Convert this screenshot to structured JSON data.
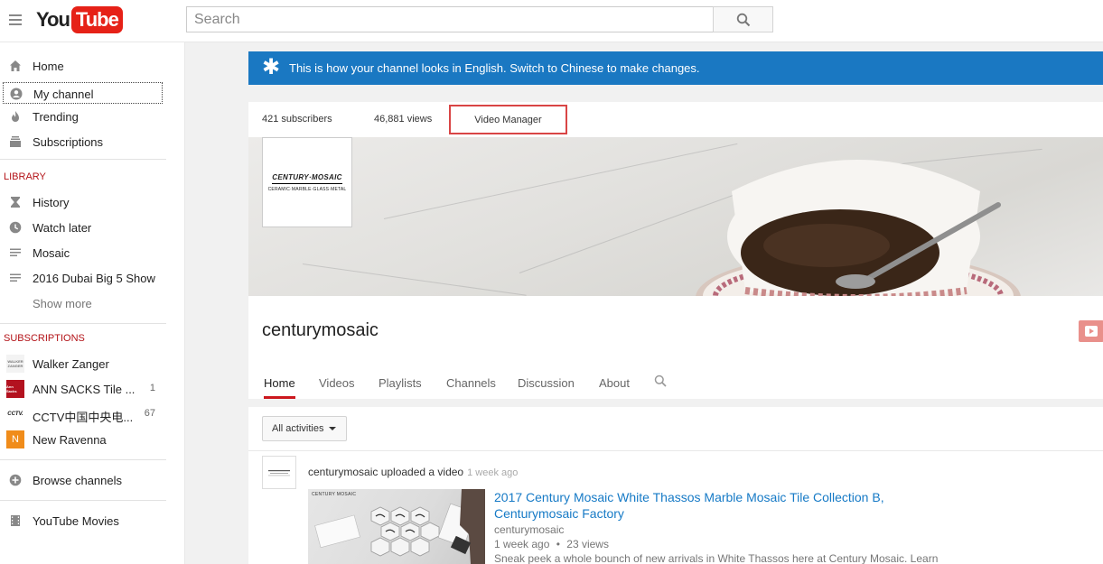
{
  "header": {
    "logo_you": "You",
    "logo_tube": "Tube",
    "search_placeholder": "Search"
  },
  "sidebar": {
    "main": [
      {
        "label": "Home",
        "icon": "home-icon"
      },
      {
        "label": "My channel",
        "icon": "user-icon"
      },
      {
        "label": "Trending",
        "icon": "flame-icon"
      },
      {
        "label": "Subscriptions",
        "icon": "subscriptions-icon"
      }
    ],
    "library_header": "LIBRARY",
    "library": [
      {
        "label": "History",
        "icon": "hourglass-icon"
      },
      {
        "label": "Watch later",
        "icon": "clock-icon"
      },
      {
        "label": "Mosaic",
        "icon": "playlist-icon"
      },
      {
        "label": "2016 Dubai Big 5 Show",
        "icon": "playlist-icon"
      }
    ],
    "show_more": "Show more",
    "subscriptions_header": "SUBSCRIPTIONS",
    "subscriptions": [
      {
        "label": "Walker Zanger",
        "count": "",
        "thumb_text": "WALKER ZANGER"
      },
      {
        "label": "ANN SACKS Tile ...",
        "count": "1",
        "thumb_text": "Ann Sacks"
      },
      {
        "label": "CCTV中国中央电...",
        "count": "67",
        "thumb_text": "CCTV."
      },
      {
        "label": "New Ravenna",
        "count": "",
        "thumb_text": "N"
      }
    ],
    "browse_channels": "Browse channels",
    "youtube_movies": "YouTube Movies"
  },
  "notice": {
    "message": "This is how your channel looks in English. Switch to Chinese to make changes."
  },
  "channel": {
    "subscribers": "421 subscribers",
    "views": "46,881 views",
    "video_manager": "Video Manager",
    "logo_line1": "CENTURY·MOSAIC",
    "logo_line2": "CERAMIC·MARBLE·GLASS·METAL",
    "name": "centurymosaic",
    "tabs": [
      "Home",
      "Videos",
      "Playlists",
      "Channels",
      "Discussion",
      "About"
    ]
  },
  "feed": {
    "filter": "All activities",
    "activity": "centurymosaic uploaded a video",
    "activity_time": "1 week ago",
    "video_title": "2017 Century Mosaic White Thassos Marble Mosaic Tile Collection B, Centurymosaic Factory",
    "video_channel": "centurymosaic",
    "video_age": "1 week ago",
    "video_views": "23 views",
    "video_desc": "Sneak peek a whole bounch of new arrivals in White Thassos here at Century Mosaic. Learn",
    "thumb_brand": "CENTURY MOSAIC"
  },
  "colors": {
    "accent_red": "#cc181e",
    "notice_blue": "#1a78c2",
    "link_blue": "#167ac6",
    "highlight_box": "#d94545"
  }
}
